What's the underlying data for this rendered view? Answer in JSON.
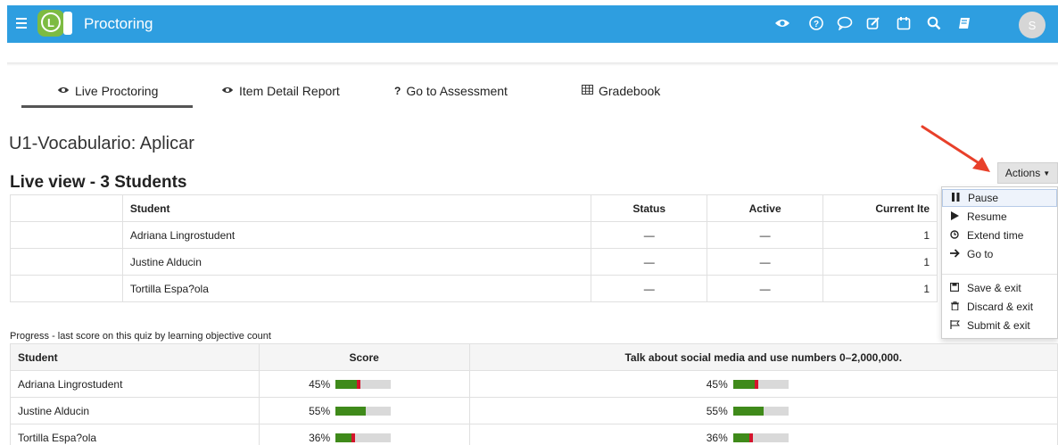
{
  "app": {
    "title": "Proctoring",
    "logo_letter": "L",
    "avatar_initial": "S"
  },
  "toolbar_icons": [
    "eye-icon",
    "help-icon",
    "chat-icon",
    "edit-icon",
    "calendar-icon",
    "search-icon",
    "book-icon"
  ],
  "tabs": [
    {
      "label": "Live Proctoring",
      "icon": "eye-icon",
      "active": true
    },
    {
      "label": "Item Detail Report",
      "icon": "eye-icon",
      "active": false
    },
    {
      "label": "Go to Assessment",
      "icon": "question-icon",
      "active": false
    },
    {
      "label": "Gradebook",
      "icon": "table-icon",
      "active": false
    }
  ],
  "quiz_title": "U1-Vocabulario: Aplicar",
  "live_heading": "Live view - 3 Students",
  "actions": {
    "label": "Actions",
    "menu": [
      {
        "label": "Pause",
        "icon": "pause-icon"
      },
      {
        "label": "Resume",
        "icon": "play-icon"
      },
      {
        "label": "Extend time",
        "icon": "clock-icon"
      },
      {
        "label": "Go to",
        "icon": "arrow-right-icon"
      },
      {
        "label": "Save & exit",
        "icon": "save-icon"
      },
      {
        "label": "Discard & exit",
        "icon": "trash-icon"
      },
      {
        "label": "Submit & exit",
        "icon": "flag-icon"
      }
    ]
  },
  "live_table": {
    "headers": [
      "Student",
      "Status",
      "Active",
      "Current Ite"
    ],
    "rows": [
      {
        "student": "Adriana Lingrostudent",
        "status": "—",
        "active": "—",
        "current": "1"
      },
      {
        "student": "Justine Alducin",
        "status": "—",
        "active": "—",
        "current": "1"
      },
      {
        "student": "Tortilla Espa?ola",
        "status": "—",
        "active": "—",
        "current": "1"
      }
    ]
  },
  "progress": {
    "caption": "Progress - last score on this quiz by learning objective count",
    "headers": [
      "Student",
      "Score",
      "Talk about social media and use numbers 0–2,000,000."
    ],
    "rows": [
      {
        "student": "Adriana Lingrostudent",
        "score": "45%",
        "objective": "45%",
        "score_value": 0.45,
        "has_red": true
      },
      {
        "student": "Justine Alducin",
        "score": "55%",
        "objective": "55%",
        "score_value": 0.55,
        "has_red": false
      },
      {
        "student": "Tortilla Espa?ola",
        "score": "36%",
        "objective": "36%",
        "score_value": 0.36,
        "has_red": true
      }
    ]
  },
  "colors": {
    "topbar": "#2e9ee0",
    "logo_green": "#7dbb42",
    "bar_green": "#3f8a1a",
    "bar_red": "#d4142c",
    "arrow_red": "#e8402a"
  }
}
